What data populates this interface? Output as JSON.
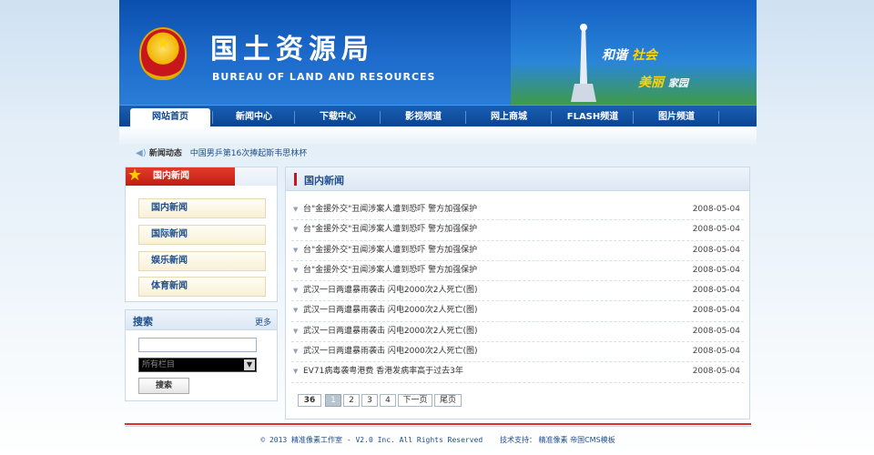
{
  "header": {
    "title": "国土资源局",
    "subtitle": "BUREAU OF LAND AND RESOURCES",
    "slogan_part1_a": "和谐",
    "slogan_part1_b": "社会",
    "slogan_part2_a": "美丽",
    "slogan_part2_b": "家园",
    "emblem_icon": "national-emblem-icon"
  },
  "nav": {
    "items": [
      {
        "label": "网站首页",
        "active": true
      },
      {
        "label": "新闻中心"
      },
      {
        "label": "下载中心"
      },
      {
        "label": "影视频道"
      },
      {
        "label": "网上商城"
      },
      {
        "label": "FLASH频道"
      },
      {
        "label": "图片频道"
      }
    ]
  },
  "ticker": {
    "icon": "speaker-icon",
    "label": "新闻动态",
    "text": "中国男乒第16次捧起斯韦思林杯"
  },
  "sidebar": {
    "categories_title": "国内新闻",
    "categories": [
      {
        "label": "国内新闻"
      },
      {
        "label": "国际新闻"
      },
      {
        "label": "娱乐新闻"
      },
      {
        "label": "体育新闻"
      }
    ],
    "search": {
      "title": "搜索",
      "more": "更多",
      "input_value": "",
      "select_value": "所有栏目",
      "button_label": "搜索"
    }
  },
  "main": {
    "title": "国内新闻",
    "news": [
      {
        "title": "台\"金援外交\"丑闻涉案人遭到恐吓 警方加强保护",
        "date": "2008-05-04"
      },
      {
        "title": "台\"金援外交\"丑闻涉案人遭到恐吓 警方加强保护",
        "date": "2008-05-04"
      },
      {
        "title": "台\"金援外交\"丑闻涉案人遭到恐吓 警方加强保护",
        "date": "2008-05-04"
      },
      {
        "title": "台\"金援外交\"丑闻涉案人遭到恐吓 警方加强保护",
        "date": "2008-05-04"
      },
      {
        "title": "武汉一日两遭暴雨袭击 闪电2000次2人死亡(图)",
        "date": "2008-05-04"
      },
      {
        "title": "武汉一日两遭暴雨袭击 闪电2000次2人死亡(图)",
        "date": "2008-05-04"
      },
      {
        "title": "武汉一日两遭暴雨袭击 闪电2000次2人死亡(图)",
        "date": "2008-05-04"
      },
      {
        "title": "武汉一日两遭暴雨袭击 闪电2000次2人死亡(图)",
        "date": "2008-05-04"
      },
      {
        "title": "EV71病毒袭粤港费 香港发病率高于过去3年",
        "date": "2008-05-04"
      }
    ],
    "pager": {
      "count": "36",
      "pages": [
        "1",
        "2",
        "3",
        "4"
      ],
      "current": "1",
      "next": "下一页",
      "last": "尾页"
    }
  },
  "footer": {
    "copyright": "© 2013 精准像素工作室 - V2.0 Inc. All Rights Reserved",
    "support_label": "技术支持：",
    "support_link1": "精准像素",
    "support_link2": "帝国CMS模板"
  },
  "colors": {
    "banner": "#1d6bcc",
    "nav": "#0b4492",
    "accent_red": "#c8161d",
    "link_blue": "#1f4f8a"
  }
}
